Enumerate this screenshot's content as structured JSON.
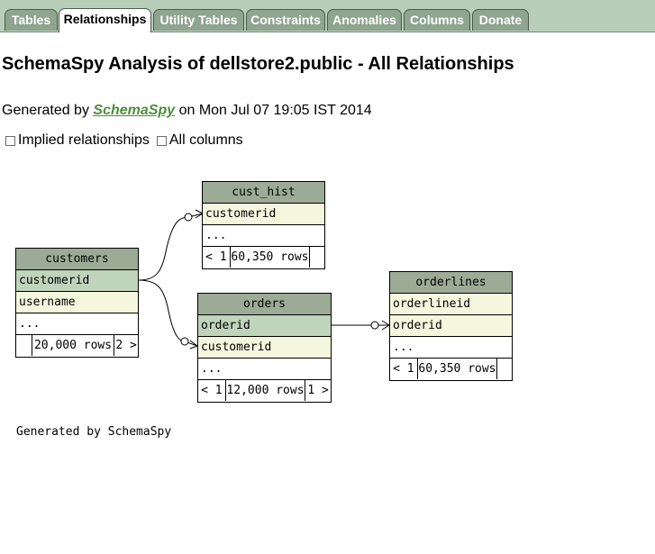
{
  "tabs": [
    {
      "label": "Tables"
    },
    {
      "label": "Relationships"
    },
    {
      "label": "Utility Tables"
    },
    {
      "label": "Constraints"
    },
    {
      "label": "Anomalies"
    },
    {
      "label": "Columns"
    },
    {
      "label": "Donate"
    }
  ],
  "active_tab": "Relationships",
  "title": "SchemaSpy Analysis of dellstore2.public - All Relationships",
  "generated": {
    "prefix": "Generated by",
    "link": "SchemaSpy",
    "suffix": "on Mon Jul 07 19:05 IST 2014"
  },
  "options": {
    "implied": "Implied relationships",
    "all_columns": "All columns"
  },
  "diagram": {
    "cust_hist": {
      "name": "cust_hist",
      "columns": [
        "customerid"
      ],
      "more": "...",
      "footer": {
        "parents": "< 1",
        "rows": "60,350 rows",
        "children": ""
      }
    },
    "customers": {
      "name": "customers",
      "columns": [
        "customerid",
        "username"
      ],
      "more": "...",
      "footer": {
        "parents": "",
        "rows": "20,000 rows",
        "children": "2 >"
      }
    },
    "orders": {
      "name": "orders",
      "columns": [
        "orderid",
        "customerid"
      ],
      "more": "...",
      "footer": {
        "parents": "< 1",
        "rows": "12,000 rows",
        "children": "1 >"
      }
    },
    "orderlines": {
      "name": "orderlines",
      "columns": [
        "orderlineid",
        "orderid"
      ],
      "more": "...",
      "footer": {
        "parents": "< 1",
        "rows": "60,350 rows",
        "children": ""
      }
    }
  },
  "footer_note": "Generated by SchemaSpy"
}
